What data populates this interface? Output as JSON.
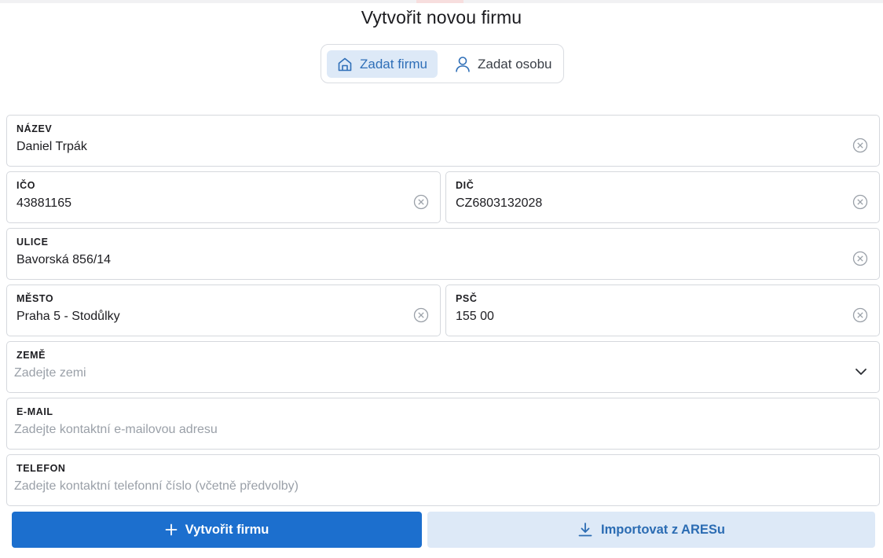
{
  "page": {
    "title": "Vytvořit novou firmu"
  },
  "toggle": {
    "company_label": "Zadat firmu",
    "person_label": "Zadat osobu"
  },
  "fields": {
    "nazev": {
      "label": "NÁZEV",
      "value": "Daniel Trpák"
    },
    "ico": {
      "label": "IČO",
      "value": "43881165"
    },
    "dic": {
      "label": "DIČ",
      "value": "CZ6803132028"
    },
    "ulice": {
      "label": "ULICE",
      "value": "Bavorská 856/14"
    },
    "mesto": {
      "label": "MĚSTO",
      "value": "Praha 5 - Stodůlky"
    },
    "psc": {
      "label": "PSČ",
      "value": "155 00"
    },
    "zeme": {
      "label": "ZEMĚ",
      "placeholder": "Zadejte zemi"
    },
    "email": {
      "label": "E-MAIL",
      "placeholder": "Zadejte kontaktní e-mailovou adresu"
    },
    "telefon": {
      "label": "TELEFON",
      "placeholder": "Zadejte kontaktní telefonní číslo (včetně předvolby)"
    }
  },
  "actions": {
    "create_label": "Vytvořit firmu",
    "import_label": "Importovat z ARESu"
  },
  "icons": {
    "company": "home-icon",
    "person": "person-icon",
    "clear": "clear-circle-icon",
    "dropdown": "chevron-down-icon",
    "create": "plus-icon",
    "import": "download-icon"
  },
  "colors": {
    "primary": "#1c6fce",
    "primary_light": "#dde9f7",
    "accent_text": "#2f6fb8",
    "border": "#d5d8dd",
    "placeholder": "#9aa0a8"
  }
}
